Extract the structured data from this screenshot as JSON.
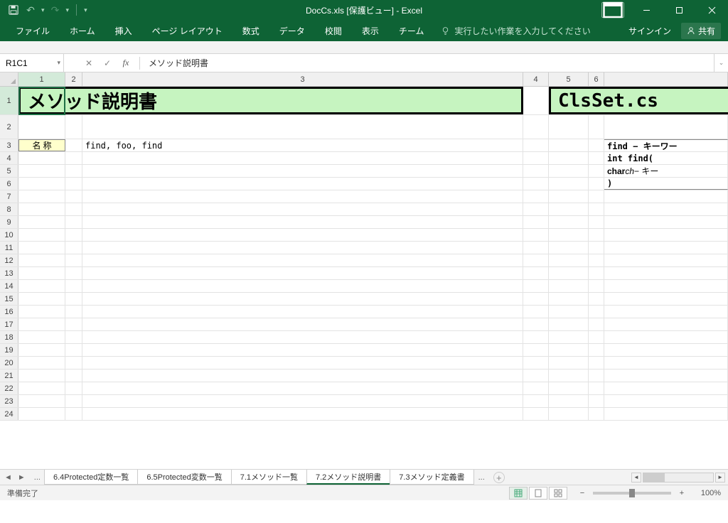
{
  "title": "DocCs.xls [保護ビュー] - Excel",
  "qat": {
    "save": "保存"
  },
  "ribbon": {
    "tabs": [
      "ファイル",
      "ホーム",
      "挿入",
      "ページ レイアウト",
      "数式",
      "データ",
      "校閲",
      "表示",
      "チーム"
    ],
    "tell_me": "実行したい作業を入力してください",
    "signin": "サインイン",
    "share": "共有"
  },
  "formula_bar": {
    "name_box": "R1C1",
    "formula": "メソッド説明書"
  },
  "columns": [
    "1",
    "2",
    "3",
    "4",
    "5",
    "6"
  ],
  "rows": [
    "1",
    "2",
    "3",
    "4",
    "5",
    "6",
    "7",
    "8",
    "9",
    "10",
    "11",
    "12",
    "13",
    "14",
    "15",
    "16",
    "17",
    "18",
    "19",
    "20",
    "21",
    "22",
    "23",
    "24"
  ],
  "cells": {
    "title_left": "メソッド説明書",
    "title_right": "ClsSet.cs",
    "r3_label": "名 称",
    "r3_value": "find, foo, find",
    "code_r3": "find − キーワー",
    "code_r4": "int find(",
    "code_r5_a": "  char ",
    "code_r5_em": "ch",
    "code_r5_b": "  − キー",
    "code_r6": ")"
  },
  "sheet_tabs": {
    "ellipsis": "...",
    "items": [
      "6.4Protected定数一覧",
      "6.5Protected変数一覧",
      "7.1メソッド一覧",
      "7.2メソッド説明書",
      "7.3メソッド定義書"
    ],
    "trailing_ellipsis": "...",
    "active_index": 3
  },
  "status": {
    "ready": "準備完了",
    "zoom": "100%"
  }
}
